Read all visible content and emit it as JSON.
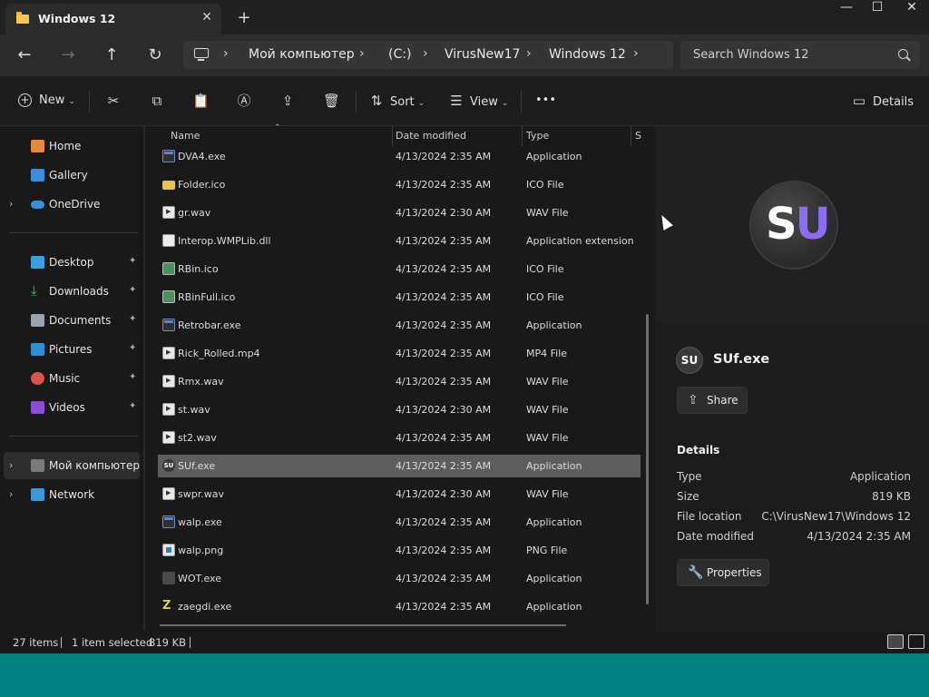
{
  "window": {
    "tab_title": "Windows 12",
    "tab_close": "✕",
    "new_tab": "+",
    "minimize": "—",
    "maximize": "☐",
    "close": "✕"
  },
  "navigation": {
    "back": "←",
    "forward": "→",
    "up": "↑",
    "refresh": "↻",
    "breadcrumb": [
      "Мой компьютер",
      "(C:)",
      "VirusNew17",
      "Windows 12"
    ],
    "search_placeholder": "Search Windows 12"
  },
  "toolbar": {
    "new_label": "New",
    "sort_label": "Sort",
    "view_label": "View",
    "more_label": "•••",
    "details_label": "Details"
  },
  "sidebar": {
    "items": [
      {
        "label": "Home",
        "icon": "home-icon"
      },
      {
        "label": "Gallery",
        "icon": "gallery-icon"
      },
      {
        "label": "OneDrive",
        "icon": "onedrive-icon"
      },
      {
        "label": "Desktop",
        "icon": "desktop-icon"
      },
      {
        "label": "Downloads",
        "icon": "downloads-icon"
      },
      {
        "label": "Documents",
        "icon": "documents-icon"
      },
      {
        "label": "Pictures",
        "icon": "pictures-icon"
      },
      {
        "label": "Music",
        "icon": "music-icon"
      },
      {
        "label": "Videos",
        "icon": "videos-icon"
      },
      {
        "label": "Мой компьютер",
        "icon": "computer-icon"
      },
      {
        "label": "Network",
        "icon": "network-icon"
      }
    ],
    "pin": "📌"
  },
  "file_list": {
    "columns": [
      "Name",
      "Date modified",
      "Type",
      "S"
    ],
    "rows": [
      {
        "name": "DVA4.exe",
        "date": "4/13/2024 2:35 AM",
        "type": "Application",
        "icon": "app"
      },
      {
        "name": "Folder.ico",
        "date": "4/13/2024 2:35 AM",
        "type": "ICO File",
        "icon": "folder"
      },
      {
        "name": "gr.wav",
        "date": "4/13/2024 2:30 AM",
        "type": "WAV File",
        "icon": "wav"
      },
      {
        "name": "Interop.WMPLib.dll",
        "date": "4/13/2024 2:35 AM",
        "type": "Application extension",
        "icon": "dll"
      },
      {
        "name": "RBin.ico",
        "date": "4/13/2024 2:35 AM",
        "type": "ICO File",
        "icon": "recycle"
      },
      {
        "name": "RBinFull.ico",
        "date": "4/13/2024 2:35 AM",
        "type": "ICO File",
        "icon": "recycle"
      },
      {
        "name": "Retrobar.exe",
        "date": "4/13/2024 2:35 AM",
        "type": "Application",
        "icon": "app"
      },
      {
        "name": "Rick_Rolled.mp4",
        "date": "4/13/2024 2:35 AM",
        "type": "MP4 File",
        "icon": "wav"
      },
      {
        "name": "Rmx.wav",
        "date": "4/13/2024 2:35 AM",
        "type": "WAV File",
        "icon": "wav"
      },
      {
        "name": "st.wav",
        "date": "4/13/2024 2:30 AM",
        "type": "WAV File",
        "icon": "wav"
      },
      {
        "name": "st2.wav",
        "date": "4/13/2024 2:35 AM",
        "type": "WAV File",
        "icon": "wav"
      },
      {
        "name": "SUf.exe",
        "date": "4/13/2024 2:35 AM",
        "type": "Application",
        "icon": "su",
        "selected": true
      },
      {
        "name": "swpr.wav",
        "date": "4/13/2024 2:30 AM",
        "type": "WAV File",
        "icon": "wav"
      },
      {
        "name": "walp.exe",
        "date": "4/13/2024 2:35 AM",
        "type": "Application",
        "icon": "app"
      },
      {
        "name": "walp.png",
        "date": "4/13/2024 2:35 AM",
        "type": "PNG File",
        "icon": "png"
      },
      {
        "name": "WOT.exe",
        "date": "4/13/2024 2:35 AM",
        "type": "Application",
        "icon": "wot"
      },
      {
        "name": "zaegdi.exe",
        "date": "4/13/2024 2:35 AM",
        "type": "Application",
        "icon": "zaeg"
      }
    ]
  },
  "preview": {
    "logo_text_1": "S",
    "logo_text_2": "U",
    "small_logo": "SU",
    "file_name": "SUf.exe",
    "share_label": "Share",
    "details_heading": "Details",
    "details": [
      {
        "key": "Type",
        "value": "Application"
      },
      {
        "key": "Size",
        "value": "819 KB"
      },
      {
        "key": "File location",
        "value": "C:\\VirusNew17\\Windows 12"
      },
      {
        "key": "Date modified",
        "value": "4/13/2024 2:35 AM"
      }
    ],
    "properties_label": "Properties"
  },
  "status": {
    "item_count": "27 items",
    "selection": "1 item selected",
    "size": "819 KB"
  },
  "colors": {
    "desktop": "#007f7f",
    "selected_row": "#5d5d5d",
    "logo_accent": "#8a6df0"
  }
}
